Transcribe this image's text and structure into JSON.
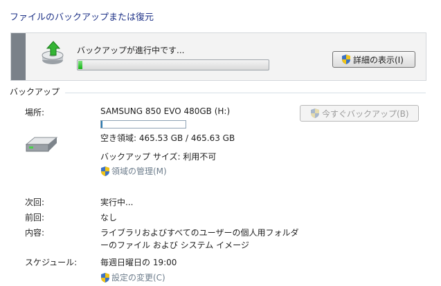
{
  "page_title": "ファイルのバックアップまたは復元",
  "status": {
    "message": "バックアップが進行中です...",
    "progress": 0.02,
    "details_button": "詳細の表示(I)"
  },
  "section_backup": {
    "header": "バックアップ",
    "location_label": "場所:",
    "location_value": "SAMSUNG 850 EVO 480GB (H:)",
    "drive_used_fraction": 0.01,
    "free_space": "空き領域: 465.53 GB / 465.63 GB",
    "backup_size": "バックアップ サイズ: 利用不可",
    "manage_space_link": "領域の管理(M)",
    "backup_now_button": "今すぐバックアップ(B)",
    "next_label": "次回:",
    "next_value": "実行中...",
    "last_label": "前回:",
    "last_value": "なし",
    "contents_label": "内容:",
    "contents_value": "ライブラリおよびすべてのユーザーの個人用フォルダーのファイル および システム イメージ",
    "schedule_label": "スケジュール:",
    "schedule_value": "毎週日曜日の 19:00",
    "change_settings_link": "設定の変更(C)"
  },
  "colors": {
    "title_blue": "#1e3287",
    "progress_green": "#14b314",
    "link_gray": "#6d7d8c"
  }
}
